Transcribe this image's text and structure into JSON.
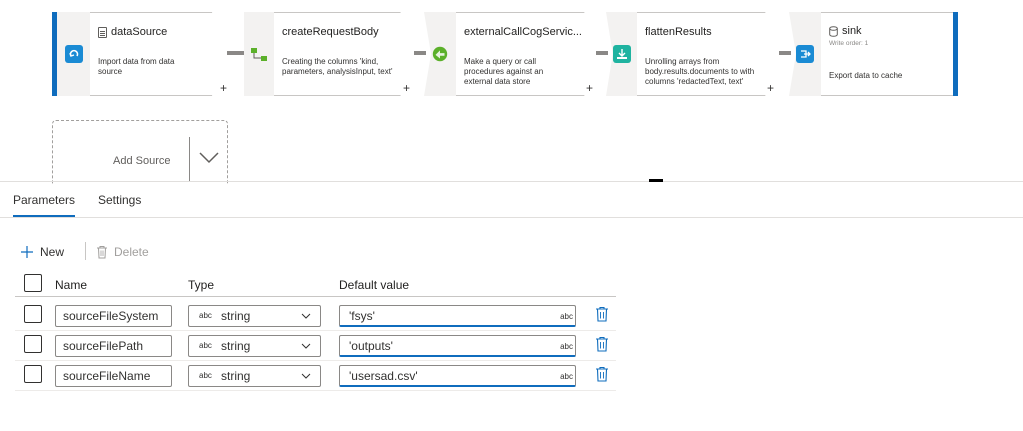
{
  "pipeline": {
    "nodes": [
      {
        "title": "dataSource",
        "desc": "Import data from data source"
      },
      {
        "title": "createRequestBody",
        "desc": "Creating the columns 'kind, parameters, analysisInput, text'"
      },
      {
        "title": "externalCallCogServic...",
        "desc": "Make a query or call procedures against an external data store"
      },
      {
        "title": "flattenResults",
        "desc": "Unrolling arrays from body.results.documents to with columns 'redactedText, text'"
      },
      {
        "title": "sink",
        "subtitle": "Write order: 1",
        "desc": "Export data to cache"
      }
    ],
    "plus_label": "+",
    "add_source_label": "Add Source"
  },
  "tabs": [
    {
      "label": "Parameters"
    },
    {
      "label": "Settings"
    }
  ],
  "toolbar": {
    "new_label": "New",
    "delete_label": "Delete"
  },
  "grid": {
    "headers": {
      "name": "Name",
      "type": "Type",
      "default": "Default value"
    },
    "type_icon_text": "abc",
    "rows": [
      {
        "name": "sourceFileSystem",
        "type": "string",
        "default": "'fsys'"
      },
      {
        "name": "sourceFilePath",
        "type": "string",
        "default": "'outputs'"
      },
      {
        "name": "sourceFileName",
        "type": "string",
        "default": "'usersad.csv'"
      }
    ]
  },
  "colors": {
    "accent": "#0f6cbd",
    "icon_blue": "#1a8bd4",
    "icon_green": "#5bb02a",
    "icon_teal": "#1fb3a0"
  }
}
